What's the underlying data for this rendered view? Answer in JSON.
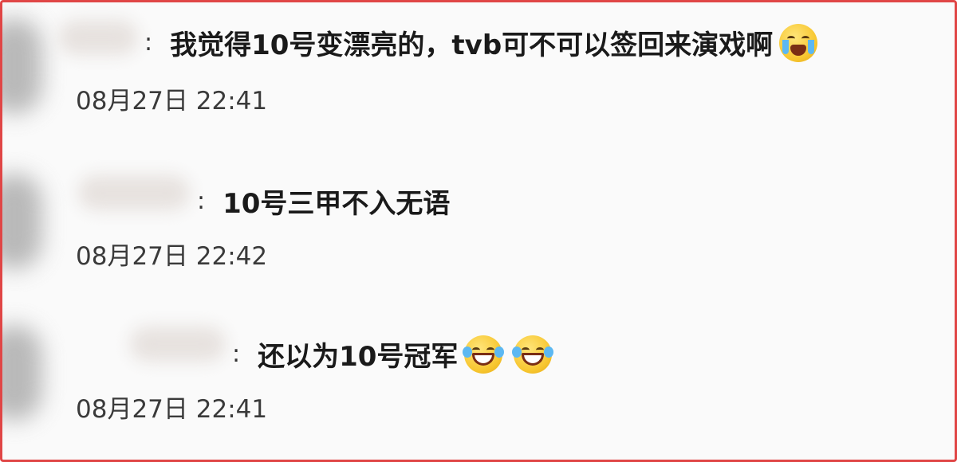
{
  "comments": [
    {
      "separator": ":",
      "text": "我觉得10号变漂亮的，tvb可不可以签回来演戏啊",
      "emojis": [
        "crying-face-icon"
      ],
      "timestamp": "08月27日 22:41"
    },
    {
      "separator": ":",
      "text": "10号三甲不入无语",
      "emojis": [],
      "timestamp": "08月27日 22:42"
    },
    {
      "separator": ":",
      "text": "还以为10号冠军",
      "emojis": [
        "laughing-crying-icon",
        "laughing-crying-icon"
      ],
      "timestamp": "08月27日 22:41"
    }
  ],
  "colors": {
    "frame_border": "#e04646",
    "text": "#1a1a1a",
    "timestamp": "#3a3a3a"
  }
}
